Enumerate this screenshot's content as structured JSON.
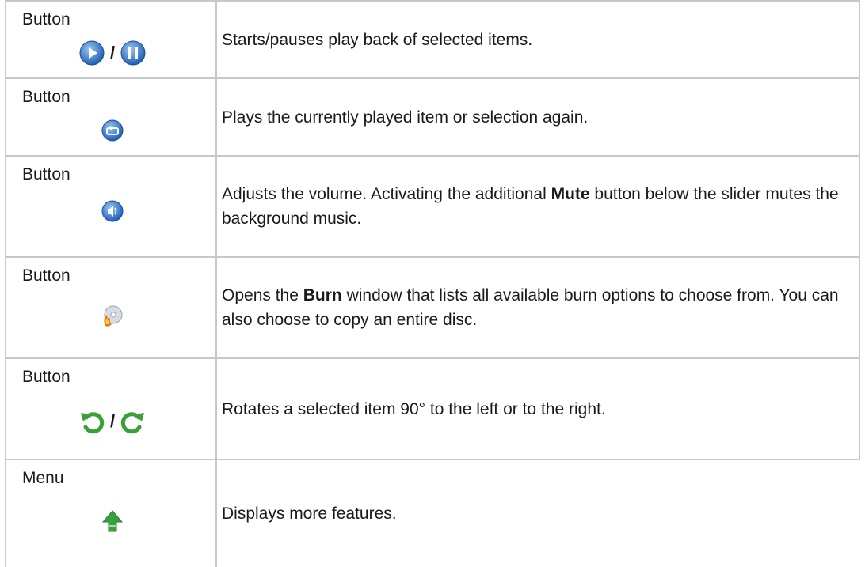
{
  "rows": [
    {
      "type": "Button",
      "icons": [
        "play-icon",
        "pause-icon"
      ],
      "separator": "/",
      "desc_parts": [
        "Starts/pauses play back of selected items."
      ]
    },
    {
      "type": "Button",
      "icons": [
        "repeat-icon"
      ],
      "desc_parts": [
        "Plays the currently played item or selection again."
      ]
    },
    {
      "type": "Button",
      "icons": [
        "volume-icon"
      ],
      "desc_parts": [
        "Adjusts the volume. Activating the additional ",
        "Mute",
        " button below the slider mutes the background music."
      ]
    },
    {
      "type": "Button",
      "icons": [
        "burn-icon"
      ],
      "desc_parts": [
        "Opens the ",
        "Burn",
        " window that lists all available burn options to choose from. You can also choose to copy an entire disc."
      ]
    },
    {
      "type": "Button",
      "icons": [
        "rotate-left-icon",
        "rotate-right-icon"
      ],
      "separator": "/",
      "desc_parts": [
        "Rotates a selected item 90° to the left or to the right."
      ]
    },
    {
      "type": "Menu",
      "icons": [
        "arrow-up-icon"
      ],
      "desc_parts": [
        "Displays more features."
      ]
    }
  ],
  "colors": {
    "border": "#c8c8c8",
    "blue": "#2f6fc4",
    "green": "#3aa13a",
    "orange": "#e8731d"
  }
}
